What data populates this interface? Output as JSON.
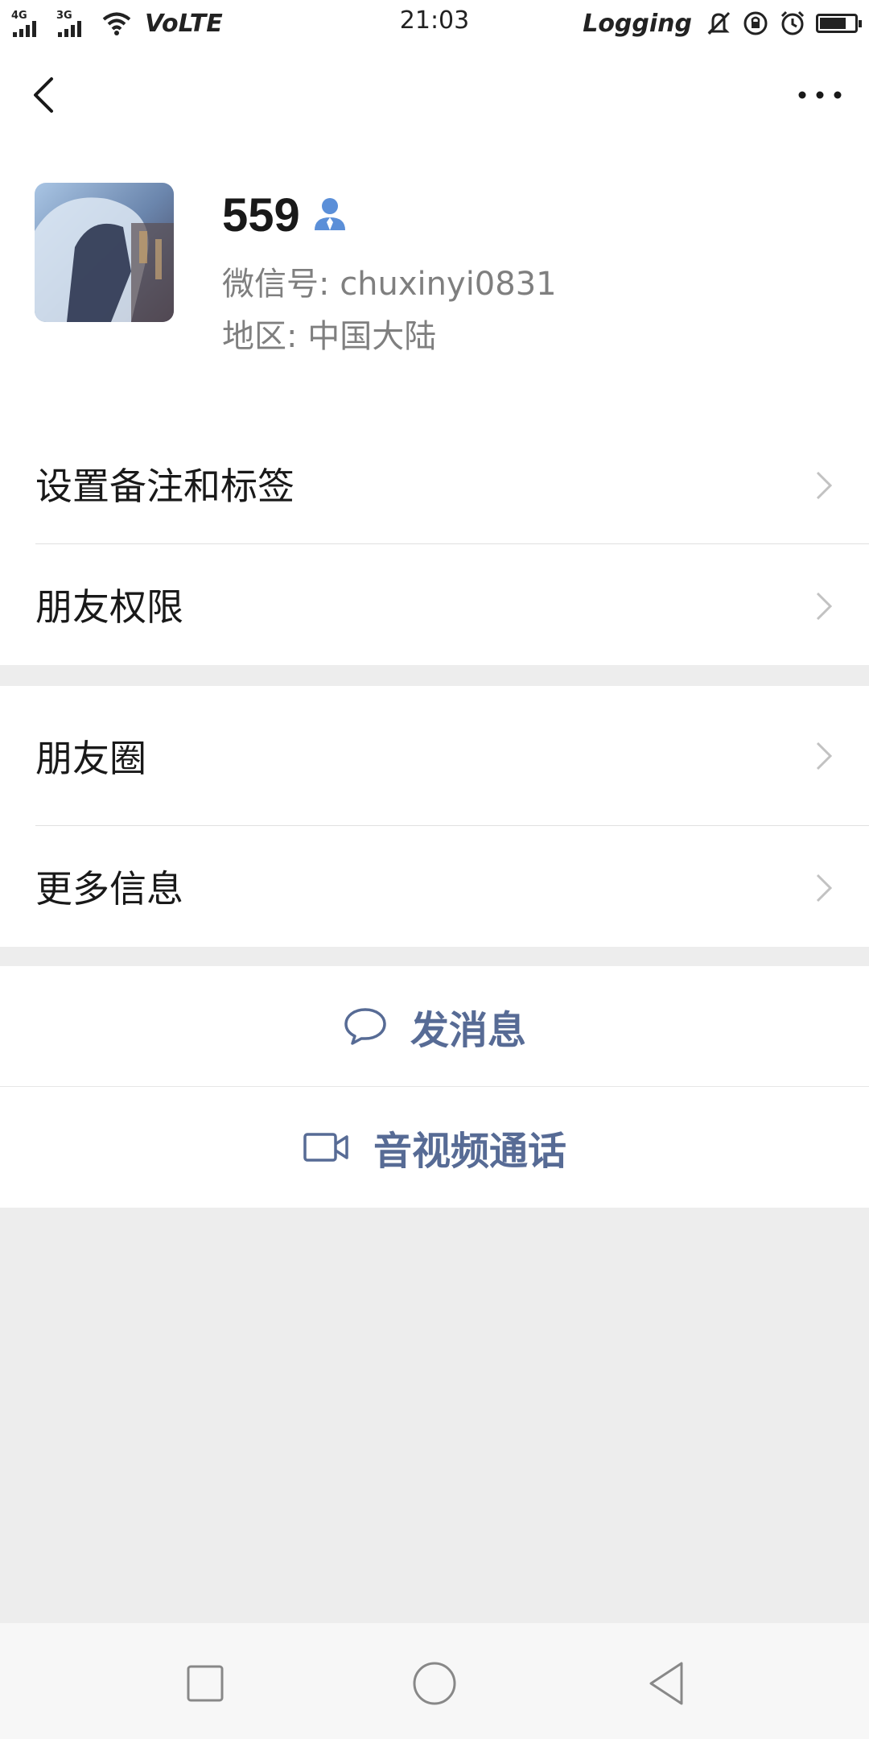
{
  "status_bar": {
    "signal1": "4G",
    "signal2": "3G",
    "network": "VoLTE",
    "time": "21:03",
    "logging": "Logging"
  },
  "nav": {
    "back_icon": "chevron-left-icon",
    "more_icon": "more-horizontal-icon"
  },
  "profile": {
    "name": "559",
    "wechat_id": "微信号: chuxinyi0831",
    "region": "地区: 中国大陆"
  },
  "menu_group_1": {
    "items": [
      {
        "label": "设置备注和标签"
      },
      {
        "label": "朋友权限"
      }
    ]
  },
  "menu_group_2": {
    "items": [
      {
        "label": "朋友圈"
      },
      {
        "label": "更多信息"
      }
    ]
  },
  "actions": {
    "send_message": "发消息",
    "av_call": "音视频通话"
  },
  "colors": {
    "link_blue": "#576b95",
    "icon_blue": "#5b8fd8",
    "background": "#ededed"
  }
}
